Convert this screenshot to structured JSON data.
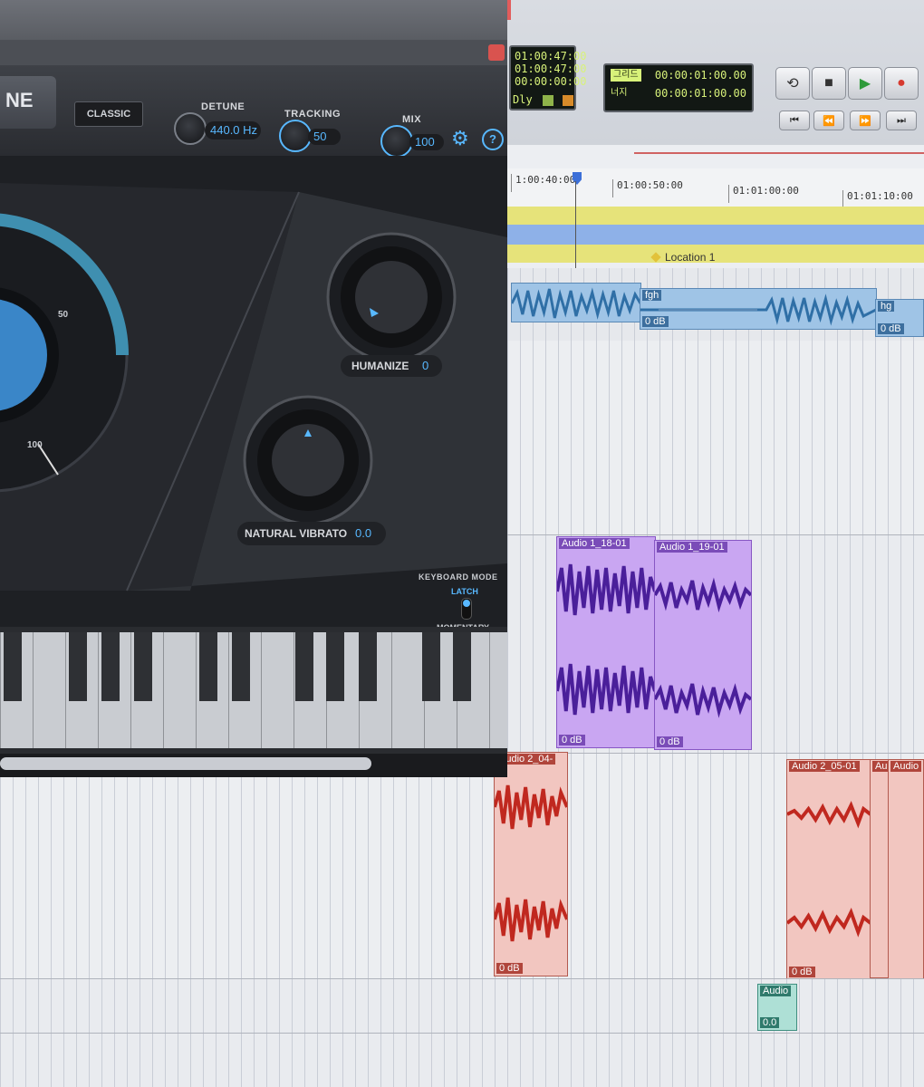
{
  "plugin": {
    "brand_fragment": "NE",
    "mode_button": "CLASSIC",
    "detune": {
      "label": "DETUNE",
      "value": "440.0 Hz"
    },
    "tracking": {
      "label": "TRACKING",
      "value": "50"
    },
    "mix": {
      "label": "MIX",
      "value": "100"
    },
    "big_knob_scale": [
      "50",
      "100"
    ],
    "humanize": {
      "label": "HUMANIZE",
      "value": "0"
    },
    "natural_vibrato": {
      "label": "NATURAL VIBRATO",
      "value": "0.0"
    },
    "keyboard_mode": {
      "label": "KEYBOARD MODE",
      "latch": "LATCH",
      "momentary": "MOMENTARY"
    },
    "close_glyph": "×"
  },
  "daw": {
    "counter_left": [
      "01:00:47:00",
      "01:00:47:00",
      "00:00:00:00"
    ],
    "dly_label": "Dly",
    "grid_row": {
      "tag": "그리드",
      "value": "00:00:01:00.00"
    },
    "nudge_row": {
      "tag": "너지",
      "value": "00:00:01:00.00"
    },
    "transport": [
      "⟲",
      "■",
      "▶",
      "●"
    ],
    "transport_small": [
      "⏮",
      "⏪",
      "⏩",
      "⏭"
    ],
    "ruler_ticks": [
      "1:00:40:00",
      "01:00:50:00",
      "01:01:00:00",
      "01:01:10:00"
    ],
    "location_marker": "Location 1",
    "clips": {
      "top_a": {
        "name": "fgh",
        "gain": "0 dB"
      },
      "top_b": {
        "name": "hg",
        "gain": "0 dB"
      },
      "purple_a": {
        "name": "Audio 1_18-01",
        "gain": "0 dB"
      },
      "purple_b": {
        "name": "Audio 1_19-01",
        "gain": "0 dB"
      },
      "red_a": {
        "name": "Audio 2_04-",
        "gain": "0 dB"
      },
      "red_b": {
        "name": "Audio 2_05-01",
        "gain": "0 dB"
      },
      "red_c": {
        "name": "Au",
        "gain": ""
      },
      "red_d": {
        "name": "Audio",
        "gain": ""
      },
      "teal": {
        "name": "Audio",
        "gain": "0.0"
      }
    }
  },
  "colors": {
    "accent_blue": "#58b8ff",
    "clip_blue": "#2f6fa6",
    "clip_purple": "#c9a6f2",
    "clip_red": "#f2c6c0",
    "lane_yellow": "#e6e37a",
    "lane_blue": "#8eb1e8"
  }
}
